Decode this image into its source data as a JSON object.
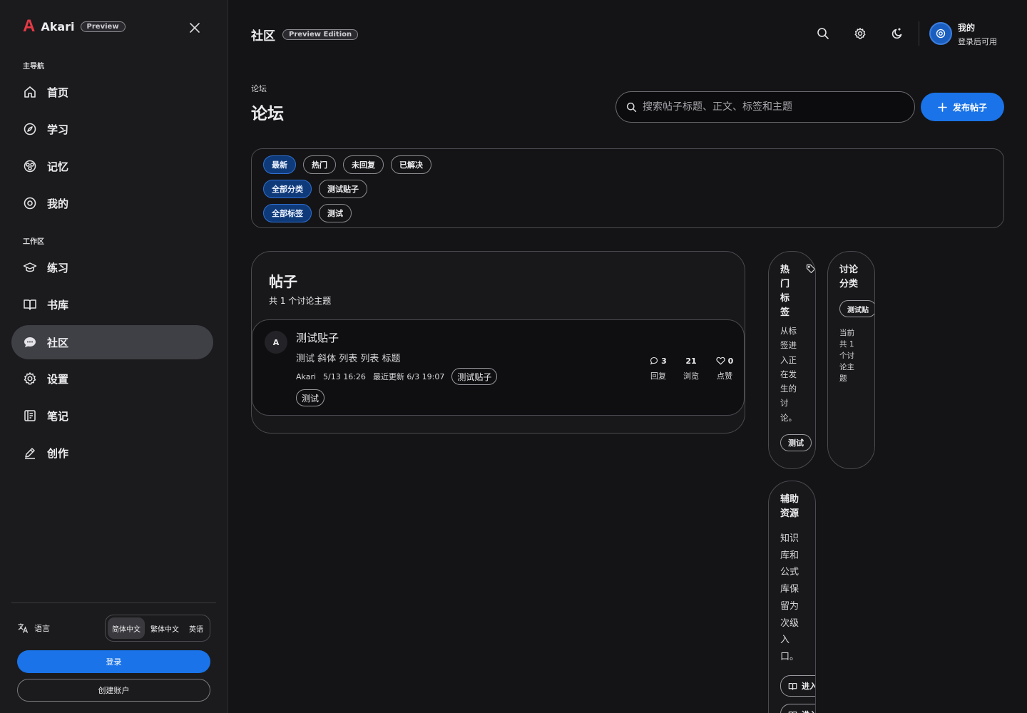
{
  "brand": {
    "name": "Akari",
    "badge": "Preview",
    "logo_letter": "A"
  },
  "sidebar": {
    "section_main": "主导航",
    "main_items": [
      {
        "label": "首页",
        "icon": "home-icon"
      },
      {
        "label": "学习",
        "icon": "compass-icon"
      },
      {
        "label": "记忆",
        "icon": "brain-icon"
      },
      {
        "label": "我的",
        "icon": "at-icon"
      }
    ],
    "section_work": "工作区",
    "work_items": [
      {
        "label": "练习",
        "icon": "graduation-cap-icon"
      },
      {
        "label": "书库",
        "icon": "book-icon"
      },
      {
        "label": "社区",
        "icon": "chat-bubble-icon",
        "active": true
      },
      {
        "label": "设置",
        "icon": "gear-icon"
      },
      {
        "label": "笔记",
        "icon": "notebook-icon"
      },
      {
        "label": "创作",
        "icon": "pen-icon"
      }
    ],
    "language_label": "语言",
    "languages": [
      "简体中文",
      "繁体中文",
      "英语"
    ],
    "selected_language": "简体中文",
    "login_label": "登录",
    "create_account_label": "创建账户"
  },
  "header": {
    "title": "社区",
    "badge": "Preview Edition",
    "user_name": "我的",
    "user_sub": "登录后可用"
  },
  "page": {
    "breadcrumb": "论坛",
    "title": "论坛",
    "search_placeholder": "搜索帖子标题、正文、标签和主题",
    "publish_label": "发布帖子"
  },
  "filters": {
    "sort": [
      {
        "label": "最新",
        "active": true
      },
      {
        "label": "热门",
        "active": false
      },
      {
        "label": "未回复",
        "active": false
      },
      {
        "label": "已解决",
        "active": false
      }
    ],
    "categories": [
      {
        "label": "全部分类",
        "active": true
      },
      {
        "label": "测试贴子",
        "active": false
      }
    ],
    "tags": [
      {
        "label": "全部标签",
        "active": true
      },
      {
        "label": "测试",
        "active": false
      }
    ]
  },
  "posts": {
    "title": "帖子",
    "subtitle": "共 1 个讨论主题",
    "items": [
      {
        "avatar": "A",
        "title": "测试贴子",
        "excerpt": "测试 斜体 列表 列表 标题",
        "author": "Akari",
        "date": "5/13 16:26",
        "updated": "最近更新 6/3 19:07",
        "category": "测试贴子",
        "tag": "测试",
        "replies": "3",
        "replies_label": "回复",
        "views": "21",
        "views_label": "浏览",
        "likes": "0",
        "likes_label": "点赞"
      }
    ]
  },
  "hot_tags": {
    "title": "热门标签",
    "text": "从标签进入正在发生的讨论。",
    "chip": "测试"
  },
  "discussion_cats": {
    "title": "讨论分类",
    "chip": "测试贴",
    "text": "当前共 1 个讨论主题"
  },
  "resources": {
    "title": "辅助资源",
    "text": "知识库和公式库保留为次级入口。",
    "link1": "进入",
    "link2": "进入"
  }
}
